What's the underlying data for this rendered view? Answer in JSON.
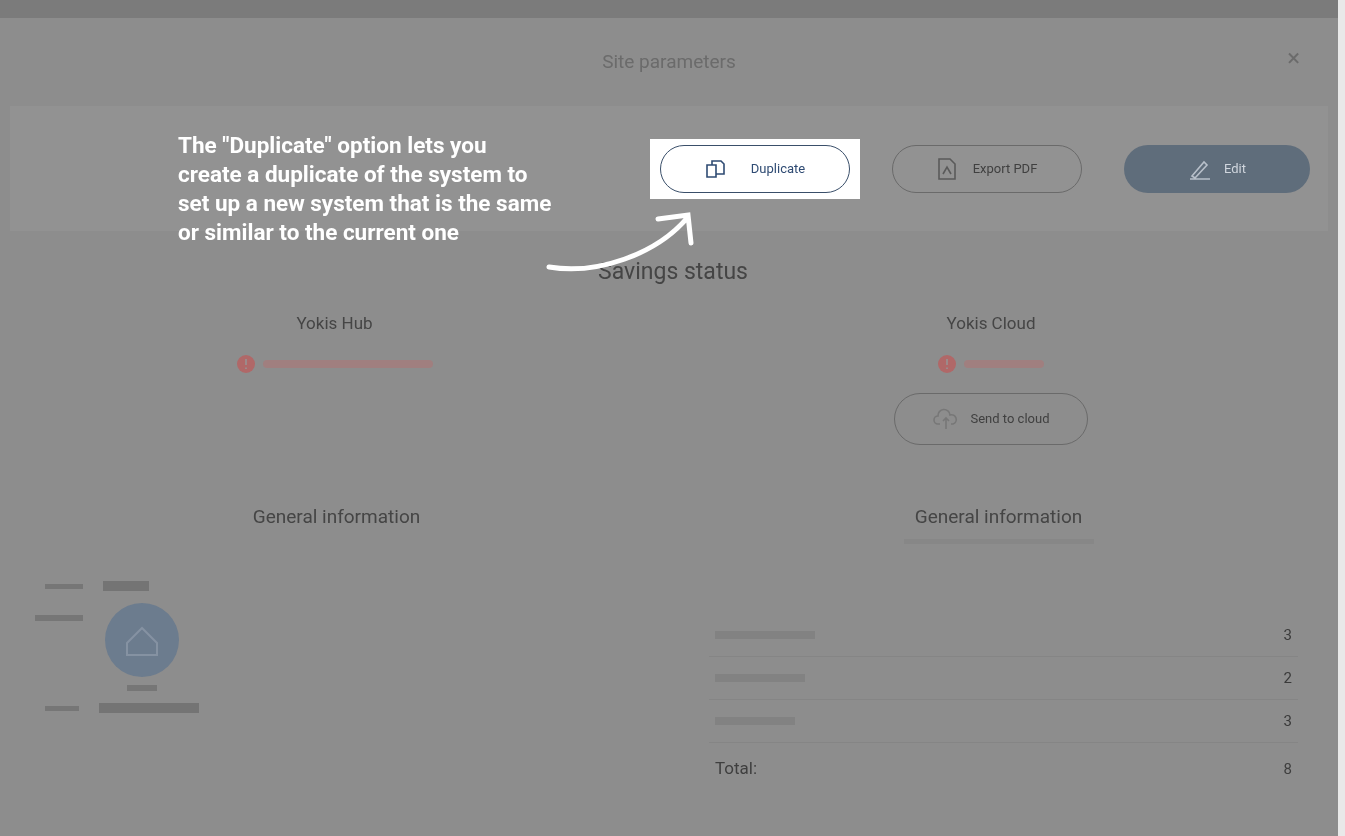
{
  "dialog": {
    "title": "Site parameters",
    "close": "×"
  },
  "actions": [
    {
      "label": "Duplicate",
      "kind": "outline",
      "highlighted": true
    },
    {
      "label": "Export PDF",
      "kind": "outline",
      "highlighted": false
    },
    {
      "label": "Edit",
      "kind": "filled",
      "highlighted": false
    }
  ],
  "savings_status": {
    "title": "Savings status",
    "columns": [
      {
        "title": "Yokis Hub"
      },
      {
        "title": "Yokis Cloud",
        "button": "Send to cloud"
      }
    ]
  },
  "general_info": [
    {
      "title": "General information"
    },
    {
      "title": "General information"
    }
  ],
  "product_counts": {
    "rows": [
      {
        "value": "3"
      },
      {
        "value": "2"
      },
      {
        "value": "3"
      }
    ],
    "total_label": "Total:",
    "total_value": "8"
  },
  "tip": {
    "text": "The \"Duplicate\" option lets you create a duplicate of the system to set up a new system that is the same or similar to the current one"
  }
}
